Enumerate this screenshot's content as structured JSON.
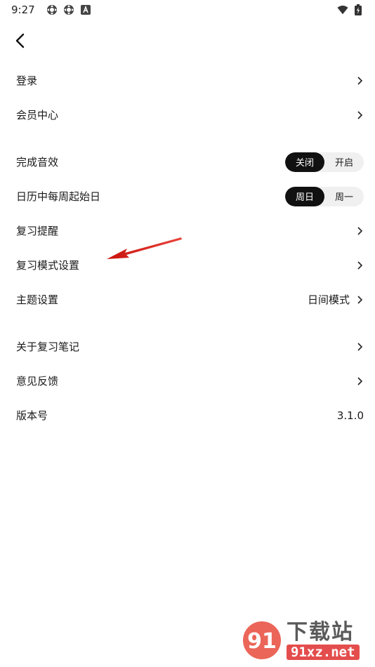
{
  "status_bar": {
    "time": "9:27",
    "icons": [
      "settings-icon",
      "settings-icon",
      "font-icon"
    ],
    "right_icons": [
      "wifi-icon",
      "battery-charging-icon"
    ]
  },
  "nav": {
    "back_icon": "chevron-left-icon"
  },
  "settings": {
    "login": {
      "label": "登录"
    },
    "membership": {
      "label": "会员中心"
    },
    "sound": {
      "label": "完成音效",
      "options": [
        "关闭",
        "开启"
      ],
      "selected": "关闭"
    },
    "week_start": {
      "label": "日历中每周起始日",
      "options": [
        "周日",
        "周一"
      ],
      "selected": "周日"
    },
    "review_reminder": {
      "label": "复习提醒"
    },
    "review_mode": {
      "label": "复习模式设置"
    },
    "theme": {
      "label": "主题设置",
      "value": "日间模式"
    },
    "about": {
      "label": "关于复习笔记"
    },
    "feedback": {
      "label": "意见反馈"
    },
    "version": {
      "label": "版本号",
      "value": "3.1.0"
    }
  },
  "annotation": {
    "color": "#d9221c"
  },
  "watermark": {
    "title": "下载站",
    "url": "91xz.net",
    "logo_text": "91"
  },
  "colors": {
    "accent": "#111111",
    "segment_bg": "#f0f0f0",
    "watermark_red": "#e23a3a"
  }
}
